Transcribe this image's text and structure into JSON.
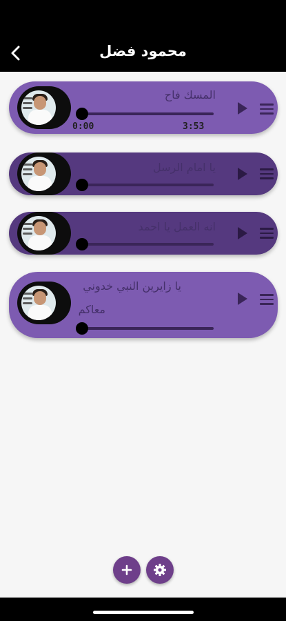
{
  "header": {
    "title": "محمود فضل",
    "back_icon": "chevron-left-icon"
  },
  "tracks": [
    {
      "title": "المسك فاح",
      "title_line2": "",
      "current_time": "0:00",
      "duration": "3:53",
      "progress": 0.0,
      "expanded": true
    },
    {
      "title": "يا امام الرسل",
      "title_line2": "",
      "current_time": "",
      "duration": "",
      "progress": 0.0,
      "expanded": false
    },
    {
      "title": "انه العمل يا احمد",
      "title_line2": "",
      "current_time": "",
      "duration": "",
      "progress": 0.0,
      "expanded": false
    },
    {
      "title": "يا زايرين النبي خدوني",
      "title_line2": "معاكم",
      "current_time": "",
      "duration": "",
      "progress": 0.0,
      "expanded": false
    }
  ],
  "actions": {
    "add_icon": "plus-icon",
    "settings_icon": "gear-icon"
  },
  "colors": {
    "header": "#000000",
    "track_light": "#7d5bb1",
    "track_dark": "#55397f",
    "fab": "#6e3f8a",
    "background": "#f6f6f6"
  }
}
